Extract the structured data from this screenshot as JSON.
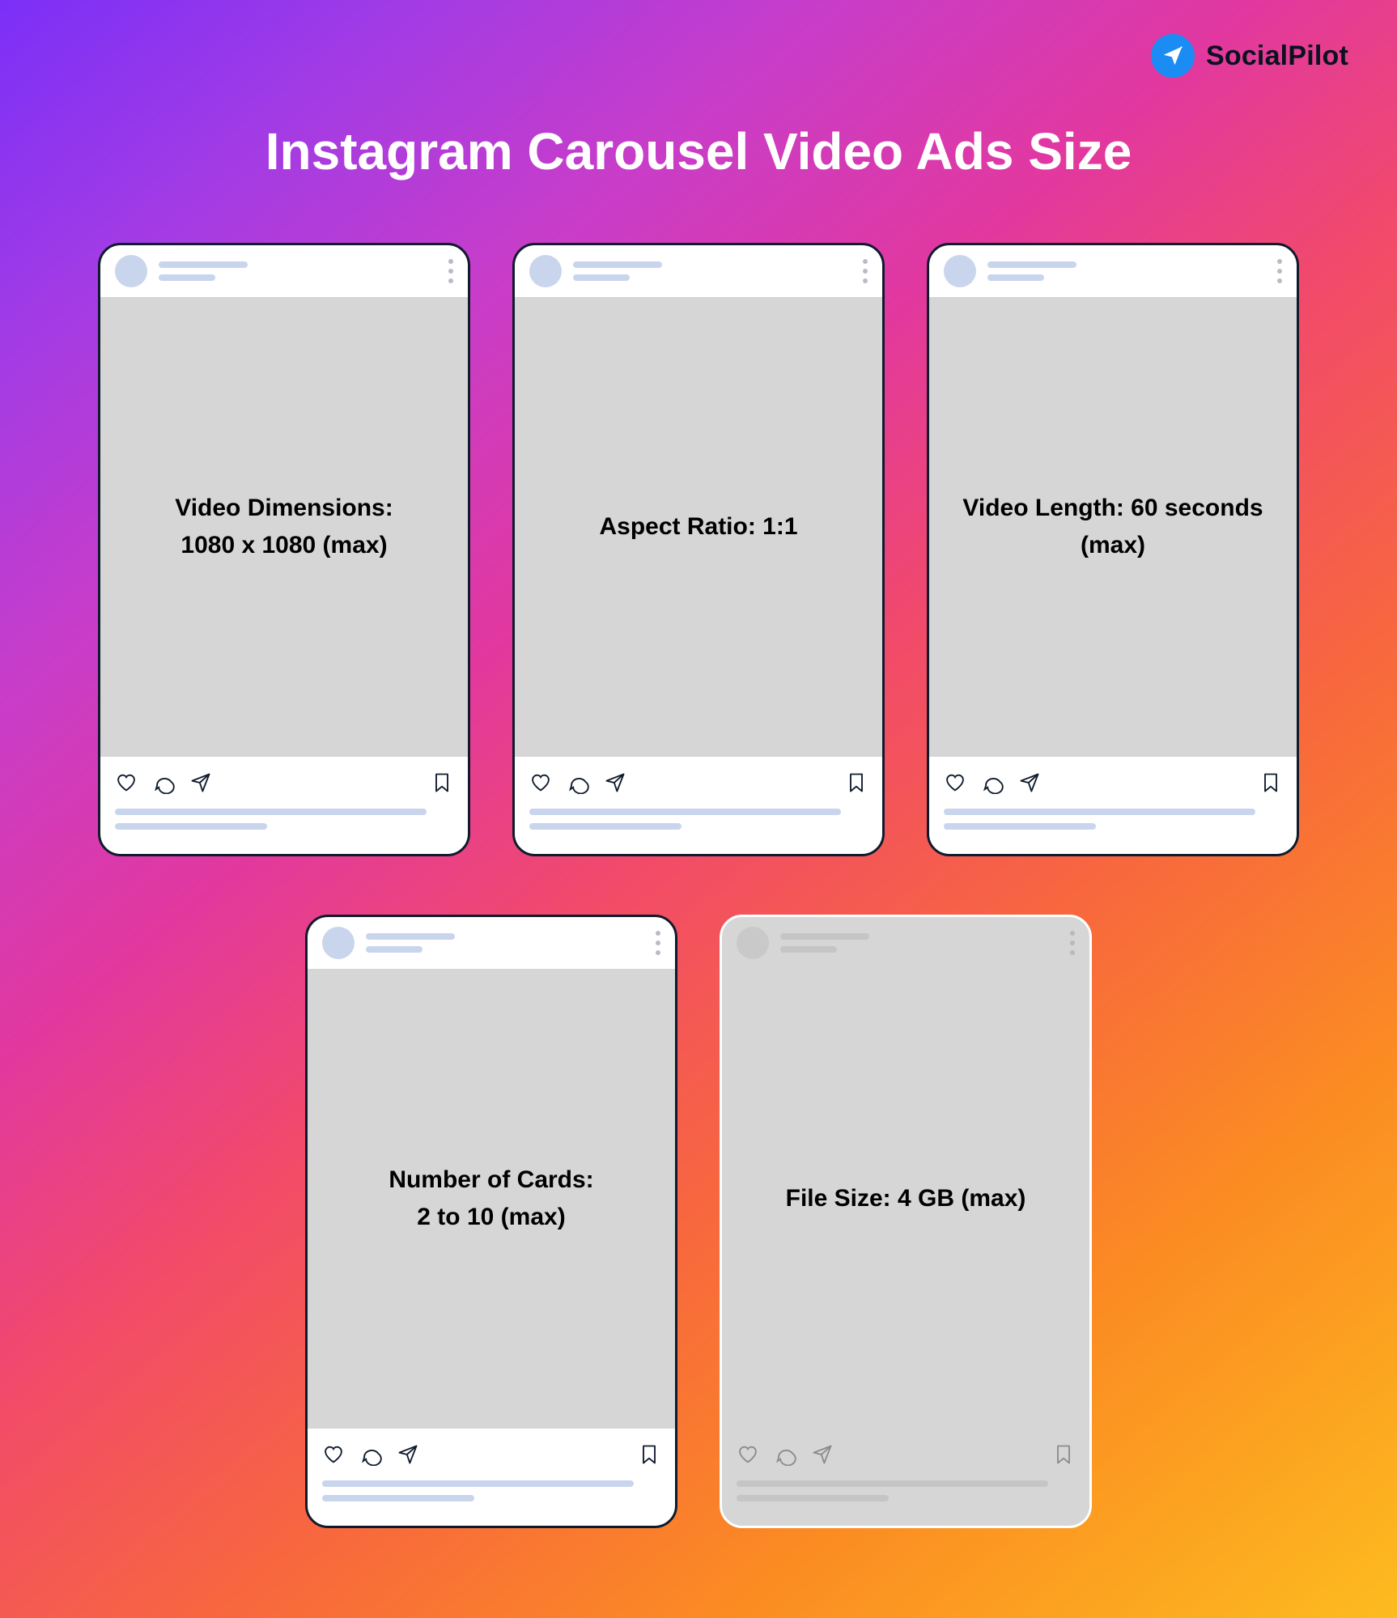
{
  "brand": {
    "name": "SocialPilot",
    "icon": "paper-plane-icon"
  },
  "title": "Instagram Carousel Video Ads Size",
  "cards": [
    {
      "text": "Video Dimensions:\n1080 x 1080 (max)",
      "ghost": false
    },
    {
      "text": "Aspect Ratio: 1:1",
      "ghost": false
    },
    {
      "text": "Video Length: 60 seconds (max)",
      "ghost": false
    },
    {
      "text": "Number of Cards:\n2 to 10 (max)",
      "ghost": false
    },
    {
      "text": "File Size: 4 GB (max)",
      "ghost": true
    }
  ],
  "icons": {
    "like": "heart-icon",
    "comment": "comment-icon",
    "share": "send-icon",
    "save": "bookmark-icon",
    "menu": "vertical-dots-icon"
  }
}
